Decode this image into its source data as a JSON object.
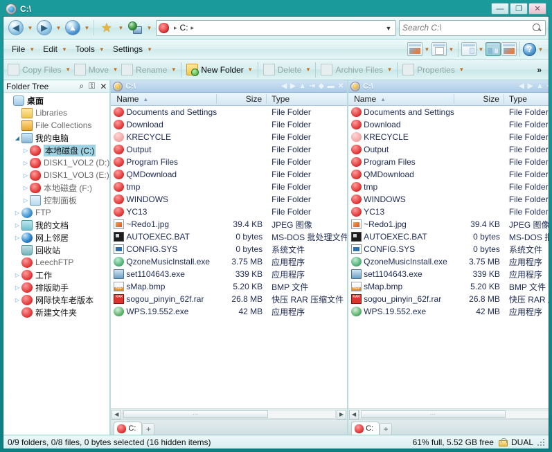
{
  "window": {
    "title": "C:\\",
    "icon": "globe-disc-icon",
    "controls": {
      "minimize": "—",
      "maximize": "❐",
      "close": "✕"
    }
  },
  "navbar": {
    "back": {
      "icon": "back-arrow-icon",
      "glyph": "◀"
    },
    "forward": {
      "icon": "forward-arrow-icon",
      "glyph": "▶"
    },
    "up": {
      "icon": "up-arrow-icon",
      "glyph": "▲"
    },
    "favorites": {
      "icon": "star-icon",
      "glyph": "★"
    },
    "network": {
      "icon": "globe-monitor-icon"
    },
    "dropdown_caret": "▼",
    "address": {
      "icon": "drive-icon",
      "crumbs": [
        "C:"
      ],
      "separator": "▸",
      "dropdown": "▼"
    },
    "search": {
      "placeholder": "Search C:\\",
      "value": "",
      "icon": "search-icon"
    }
  },
  "menubar": {
    "items": [
      {
        "label": "File",
        "accel": "F"
      },
      {
        "label": "Edit",
        "accel": "E"
      },
      {
        "label": "Tools",
        "accel": "T"
      },
      {
        "label": "Settings",
        "accel": "S"
      }
    ],
    "caret": "▼",
    "right_tools": [
      {
        "name": "preview-pane-icon",
        "has_caret": true
      },
      {
        "name": "edit-note-icon",
        "has_caret": true
      },
      {
        "name": "single-pane-layout-icon",
        "has_caret": true
      },
      {
        "name": "dual-pane-layout-icon",
        "has_caret": false,
        "active": true
      },
      {
        "name": "preview-layout-icon",
        "has_caret": false
      },
      {
        "name": "help-icon",
        "has_caret": true,
        "glyph": "?"
      }
    ]
  },
  "toolbar": {
    "buttons": [
      {
        "label": "Copy Files",
        "accel": "C",
        "icon": "copy-files-icon",
        "disabled": true,
        "caret": true
      },
      {
        "label": "Move",
        "accel": "M",
        "icon": "move-icon",
        "disabled": true,
        "caret": true
      },
      {
        "label": "Rename",
        "accel": "a",
        "icon": "rename-icon",
        "disabled": true,
        "caret": true
      },
      {
        "label": "New Folder",
        "accel": "w",
        "icon": "new-folder-icon",
        "disabled": false,
        "caret": true
      },
      {
        "label": "Delete",
        "accel": "D",
        "icon": "delete-icon",
        "disabled": true,
        "caret": true
      },
      {
        "label": "Archive Files",
        "accel": "h",
        "icon": "archive-files-icon",
        "disabled": true,
        "caret": true
      },
      {
        "label": "Properties",
        "accel": "r",
        "icon": "properties-icon",
        "disabled": true,
        "caret": true
      }
    ],
    "overflow": "»"
  },
  "tree_pane": {
    "title": "Folder Tree",
    "header_icons": [
      {
        "name": "search-icon",
        "glyph": "⌕"
      },
      {
        "name": "unlock-icon",
        "glyph": "⚿"
      },
      {
        "name": "close-icon",
        "glyph": "✕"
      }
    ],
    "nodes": [
      {
        "label": "桌面",
        "icon": "desktop-icon",
        "indent": 0,
        "arrow": "",
        "bold": true,
        "selected": false,
        "grey": false
      },
      {
        "label": "Libraries",
        "icon": "libraries-icon",
        "indent": 1,
        "arrow": "",
        "bold": false,
        "selected": false,
        "grey": true
      },
      {
        "label": "File Collections",
        "icon": "file-collections-icon",
        "indent": 1,
        "arrow": "",
        "bold": false,
        "selected": false,
        "grey": true
      },
      {
        "label": "我的电脑",
        "icon": "my-computer-icon",
        "indent": 1,
        "arrow": "open",
        "bold": false,
        "selected": false,
        "grey": false
      },
      {
        "label": "本地磁盘 (C:)",
        "icon": "drive-icon",
        "indent": 2,
        "arrow": "▷",
        "bold": false,
        "selected": true,
        "grey": false
      },
      {
        "label": "DISK1_VOL2 (D:)",
        "icon": "drive-icon",
        "indent": 2,
        "arrow": "▷",
        "bold": false,
        "selected": false,
        "grey": true
      },
      {
        "label": "DISK1_VOL3 (E:)",
        "icon": "drive-icon",
        "indent": 2,
        "arrow": "▷",
        "bold": false,
        "selected": false,
        "grey": true
      },
      {
        "label": "本地磁盘 (F:)",
        "icon": "drive-icon",
        "indent": 2,
        "arrow": "▷",
        "bold": false,
        "selected": false,
        "grey": true
      },
      {
        "label": "控制面板",
        "icon": "control-panel-icon",
        "indent": 2,
        "arrow": "▷",
        "bold": false,
        "selected": false,
        "grey": true
      },
      {
        "label": "FTP",
        "icon": "ftp-icon",
        "indent": 1,
        "arrow": "▷",
        "bold": false,
        "selected": false,
        "grey": true
      },
      {
        "label": "我的文档",
        "icon": "my-documents-icon",
        "indent": 1,
        "arrow": "▷",
        "bold": false,
        "selected": false,
        "grey": false
      },
      {
        "label": "网上邻居",
        "icon": "network-places-icon",
        "indent": 1,
        "arrow": "▷",
        "bold": false,
        "selected": false,
        "grey": false
      },
      {
        "label": "回收站",
        "icon": "recycle-bin-icon",
        "indent": 1,
        "arrow": "",
        "bold": false,
        "selected": false,
        "grey": false
      },
      {
        "label": "LeechFTP",
        "icon": "folder-red-icon",
        "indent": 1,
        "arrow": "",
        "bold": false,
        "selected": false,
        "grey": true
      },
      {
        "label": "工作",
        "icon": "folder-red-icon",
        "indent": 1,
        "arrow": "▷",
        "bold": false,
        "selected": false,
        "grey": false
      },
      {
        "label": "排版助手",
        "icon": "folder-red-icon",
        "indent": 1,
        "arrow": "▷",
        "bold": false,
        "selected": false,
        "grey": false
      },
      {
        "label": "网际快车老版本",
        "icon": "folder-red-icon",
        "indent": 1,
        "arrow": "▷",
        "bold": false,
        "selected": false,
        "grey": false
      },
      {
        "label": "新建文件夹",
        "icon": "folder-red-icon",
        "indent": 1,
        "arrow": "",
        "bold": false,
        "selected": false,
        "grey": false
      }
    ]
  },
  "file_panes": {
    "columns": {
      "name": "Name",
      "size": "Size",
      "type": "Type",
      "sort_arrow": "▲"
    },
    "title_buttons": [
      "◀",
      "▶",
      "▲",
      "⇥",
      "◆",
      "▬",
      "✕"
    ],
    "left": {
      "title": "C:\\",
      "tab": {
        "label": "C:",
        "icon": "drive-icon"
      },
      "add_tab": "+"
    },
    "right": {
      "title": "C:\\",
      "tab": {
        "label": "C:",
        "icon": "drive-icon"
      },
      "add_tab": "+"
    },
    "rows": [
      {
        "name": "Documents and Settings",
        "size": "",
        "type": "File Folder",
        "icon": "folder-red-icon"
      },
      {
        "name": "Download",
        "size": "",
        "type": "File Folder",
        "icon": "folder-red-icon"
      },
      {
        "name": "KRECYCLE",
        "size": "",
        "type": "File Folder",
        "icon": "folder-pale-icon"
      },
      {
        "name": "Output",
        "size": "",
        "type": "File Folder",
        "icon": "folder-red-icon"
      },
      {
        "name": "Program Files",
        "size": "",
        "type": "File Folder",
        "icon": "folder-red-icon"
      },
      {
        "name": "QMDownload",
        "size": "",
        "type": "File Folder",
        "icon": "folder-red-icon"
      },
      {
        "name": "tmp",
        "size": "",
        "type": "File Folder",
        "icon": "folder-red-icon"
      },
      {
        "name": "WINDOWS",
        "size": "",
        "type": "File Folder",
        "icon": "folder-red-icon"
      },
      {
        "name": "YC13",
        "size": "",
        "type": "File Folder",
        "icon": "folder-red-icon"
      },
      {
        "name": "~Redo1.jpg",
        "size": "39.4 KB",
        "type": "JPEG 图像",
        "icon": "jpeg-file-icon"
      },
      {
        "name": "AUTOEXEC.BAT",
        "size": "0 bytes",
        "type": "MS-DOS 批处理文件",
        "icon": "bat-file-icon"
      },
      {
        "name": "CONFIG.SYS",
        "size": "0 bytes",
        "type": "系统文件",
        "icon": "sys-file-icon"
      },
      {
        "name": "QzoneMusicInstall.exe",
        "size": "3.75 MB",
        "type": "应用程序",
        "icon": "exe-qzone-icon"
      },
      {
        "name": "set1104643.exe",
        "size": "339 KB",
        "type": "应用程序",
        "icon": "exe-setup-icon"
      },
      {
        "name": "sMap.bmp",
        "size": "5.20 KB",
        "type": "BMP 文件",
        "icon": "bmp-file-icon"
      },
      {
        "name": "sogou_pinyin_62f.rar",
        "size": "26.8 MB",
        "type": "快压 RAR 压缩文件",
        "icon": "rar-file-icon"
      },
      {
        "name": "WPS.19.552.exe",
        "size": "42 MB",
        "type": "应用程序",
        "icon": "exe-wps-icon"
      }
    ]
  },
  "statusbar": {
    "left": "0/9 folders, 0/8 files, 0 bytes selected (16 hidden items)",
    "disk": "61% full, 5.52 GB free",
    "lock_icon": "unlocked-padlock-icon",
    "mode": "DUAL"
  }
}
